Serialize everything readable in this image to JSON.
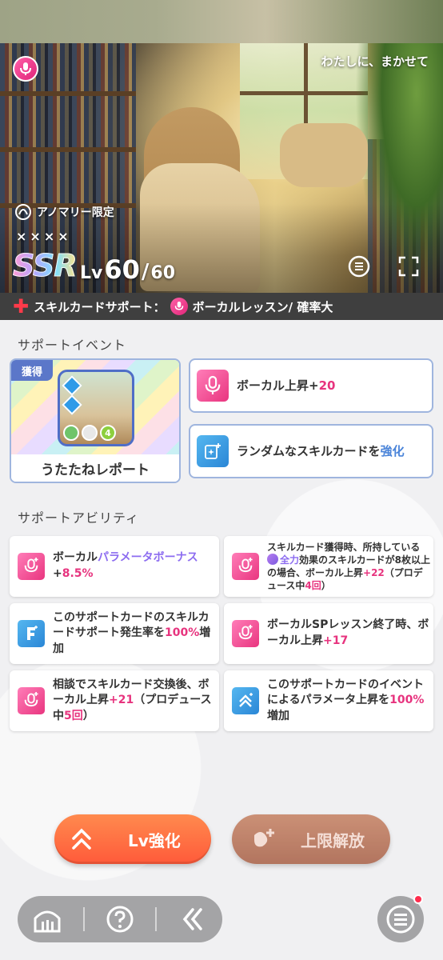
{
  "hero": {
    "catchphrase": "わたしに、まかせて",
    "limited_label": "アノマリー限定",
    "stars": [
      "×",
      "×",
      "×",
      "×"
    ],
    "rarity": "SSR",
    "level_label": "Lv",
    "level_current": "60",
    "level_separator": "/",
    "level_max": "60",
    "icons": {
      "type_badge": "microphone-icon",
      "limited": "anomaly-icon",
      "detail": "detail-list-icon",
      "fullscreen": "fullscreen-icon"
    }
  },
  "support_bar": {
    "label": "スキルカードサポート：",
    "value": "ボーカルレッスン/ 確率大"
  },
  "events": {
    "section_title": "サポートイベント",
    "event_card": {
      "badge": "獲得",
      "name": "うたたねレポート",
      "thumb_number": "4"
    },
    "items": [
      {
        "prefix": "ボーカル上昇+",
        "highlight": "20",
        "suffix": "",
        "icon": "microphone-icon"
      },
      {
        "prefix": "ランダムなスキルカードを",
        "highlight": "強化",
        "suffix": "",
        "icon": "card-sparkle-icon"
      }
    ]
  },
  "abilities": {
    "section_title": "サポートアビリティ",
    "items": [
      {
        "p1": "ボーカル",
        "h1": "パラメータボーナス",
        "p2": "+",
        "h2": "8.5%",
        "p3": ""
      },
      {
        "p1": "スキルカード獲得時、所持している",
        "tag": "全力",
        "p2": "効果のスキルカードが8枚以上の場合、ボーカル上昇",
        "h1": "+22",
        "p3": "（プロデュース中",
        "h2": "4回",
        "p4": "）"
      },
      {
        "p1": "このサポートカードのスキルカードサポート発生率を",
        "h1": "100%",
        "p2": "増加"
      },
      {
        "p1": "ボーカルSPレッスン終了時、ボーカル上昇",
        "h1": "+17",
        "p2": ""
      },
      {
        "p1": "相談でスキルカード交換後、ボーカル上昇",
        "h1": "+21",
        "p2": "（プロデュース中",
        "h2": "5回",
        "p3": "）"
      },
      {
        "p1": "このサポートカードのイベントによるパラメータ上昇を",
        "h1": "100%",
        "p2": "増加"
      }
    ]
  },
  "buttons": {
    "enhance": "Lv強化",
    "limit_break": "上限解放"
  },
  "nav": {
    "home": "home-icon",
    "help": "help-icon",
    "back": "back-icon",
    "menu": "menu-icon"
  },
  "colors": {
    "accent_pink": "#e7337e",
    "accent_purple": "#8c6cf0",
    "enhance_orange": "#ff6a40",
    "limit_brown": "#b86e52",
    "border_blue": "#9fb5de"
  }
}
